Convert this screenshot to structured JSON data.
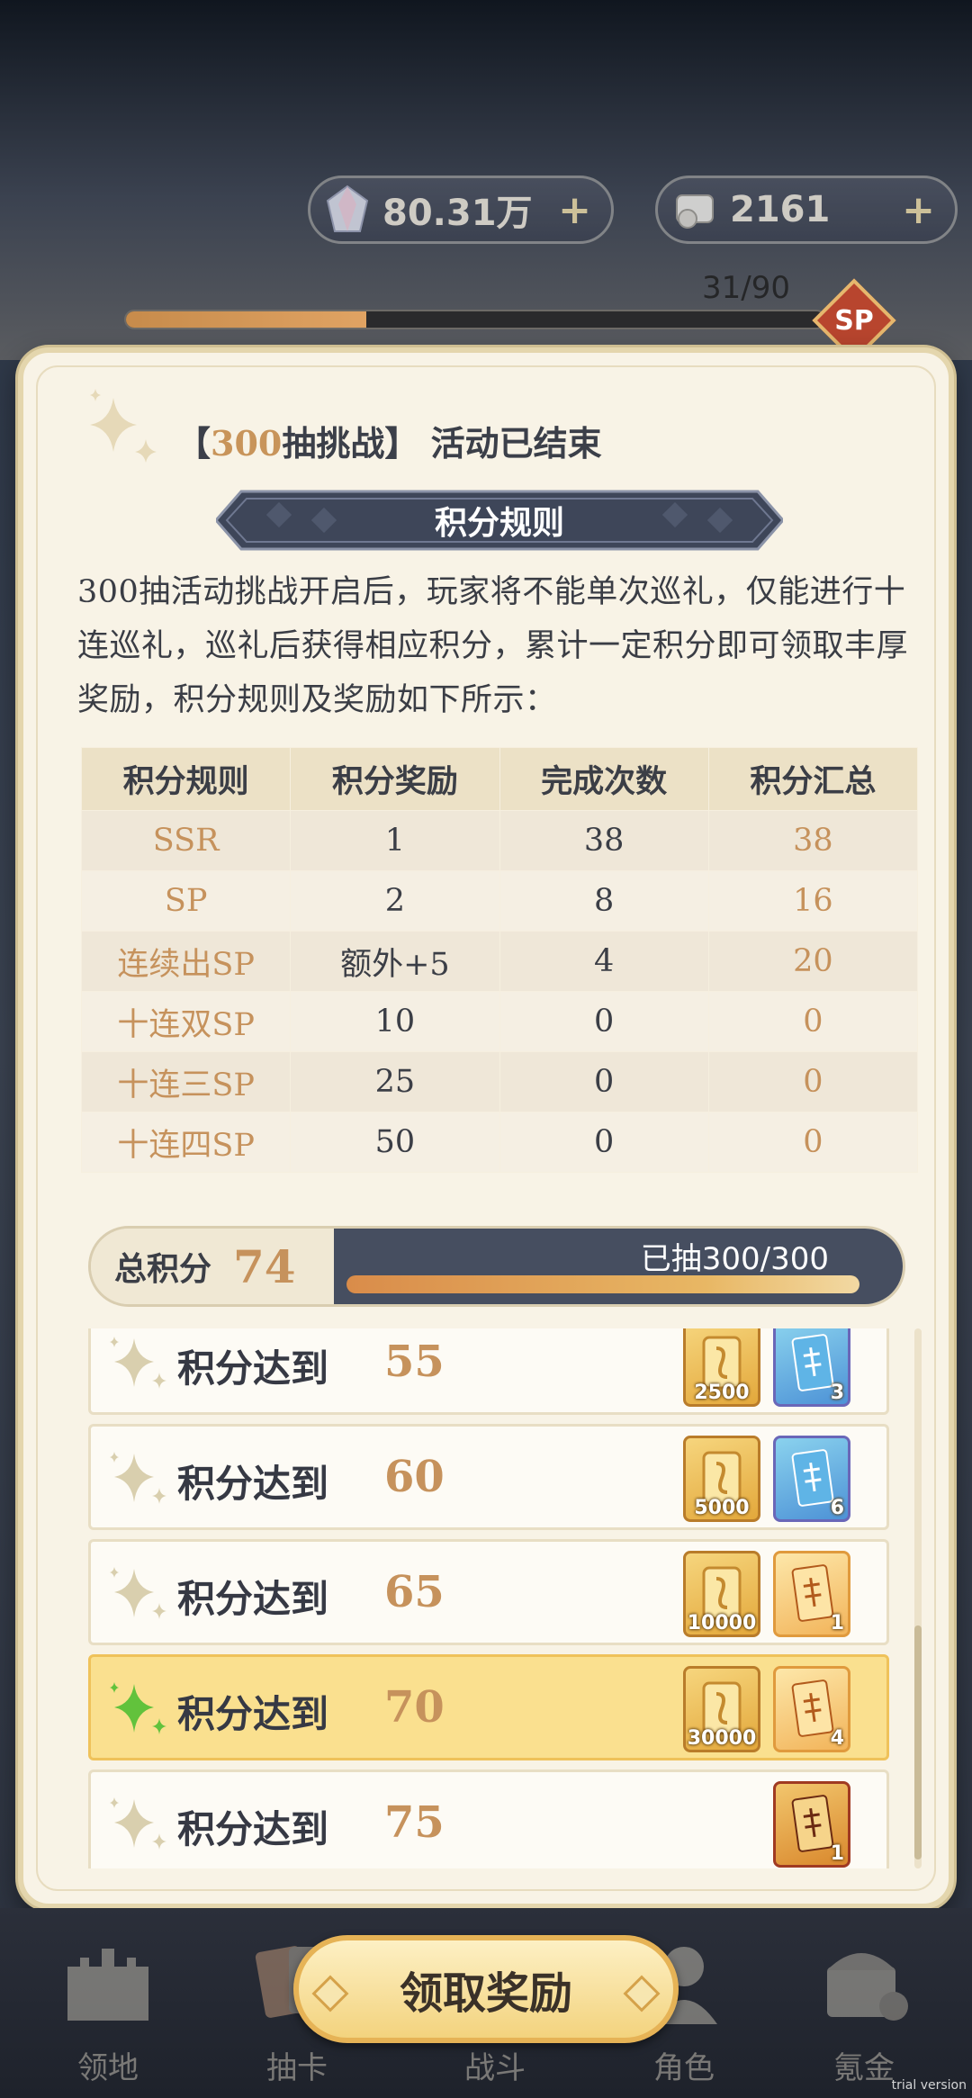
{
  "header": {
    "gem_value": "80.31万",
    "ticket_value": "2161",
    "pity_text": "31/90",
    "pity_fraction": 0.344,
    "sp_badge": "SP"
  },
  "dialog": {
    "title_highlight": "300",
    "title_rest": "抽挑战】 活动已结束",
    "title_prefix": "【",
    "rules_banner": "积分规则",
    "description": "300抽活动挑战开启后，玩家将不能单次巡礼，仅能进行十连巡礼，巡礼后获得相应积分，累计一定积分即可领取丰厚奖励，积分规则及奖励如下所示：",
    "table": {
      "headers": [
        "积分规则",
        "积分奖励",
        "完成次数",
        "积分汇总"
      ],
      "rows": [
        {
          "rule": "SSR",
          "reward": "1",
          "count": "38",
          "total": "38"
        },
        {
          "rule": "SP",
          "reward": "2",
          "count": "8",
          "total": "16"
        },
        {
          "rule": "连续出SP",
          "reward": "额外+5",
          "count": "4",
          "total": "20"
        },
        {
          "rule": "十连双SP",
          "reward": "10",
          "count": "0",
          "total": "0"
        },
        {
          "rule": "十连三SP",
          "reward": "25",
          "count": "0",
          "total": "0"
        },
        {
          "rule": "十连四SP",
          "reward": "50",
          "count": "0",
          "total": "0"
        }
      ]
    },
    "total": {
      "label": "总积分",
      "value": "74",
      "drawn_text": "已抽300/300",
      "progress_fraction": 1.0
    },
    "rewards": [
      {
        "label": "积分达到",
        "score": "55",
        "active": false,
        "items": [
          {
            "type": "gold",
            "qty": "2500"
          },
          {
            "type": "blue",
            "qty": "3",
            "glyph": "免\n小四"
          }
        ]
      },
      {
        "label": "积分达到",
        "score": "60",
        "active": false,
        "items": [
          {
            "type": "gold",
            "qty": "5000"
          },
          {
            "type": "blue",
            "qty": "6",
            "glyph": "免\n小四"
          }
        ]
      },
      {
        "label": "积分达到",
        "score": "65",
        "active": false,
        "items": [
          {
            "type": "gold",
            "qty": "10000"
          },
          {
            "type": "orange",
            "qty": "1",
            "glyph": "免\n小四"
          }
        ]
      },
      {
        "label": "积分达到",
        "score": "70",
        "active": true,
        "items": [
          {
            "type": "gold",
            "qty": "30000"
          },
          {
            "type": "orange",
            "qty": "4",
            "glyph": "免\n小四"
          }
        ]
      },
      {
        "label": "积分达到",
        "score": "75",
        "active": false,
        "items": [
          {
            "type": "red",
            "qty": "1",
            "glyph": "免\n尸"
          }
        ]
      }
    ]
  },
  "nav": {
    "items": [
      "领地",
      "抽卡",
      "战斗",
      "角色",
      "氪金"
    ],
    "claim_label": "领取奖励"
  },
  "watermark": "trial version",
  "colors": {
    "accent_gold": "#c6925c",
    "dark_navy": "#464e60",
    "dialog_bg": "#f8f3e6",
    "active_row": "#fae08f"
  }
}
